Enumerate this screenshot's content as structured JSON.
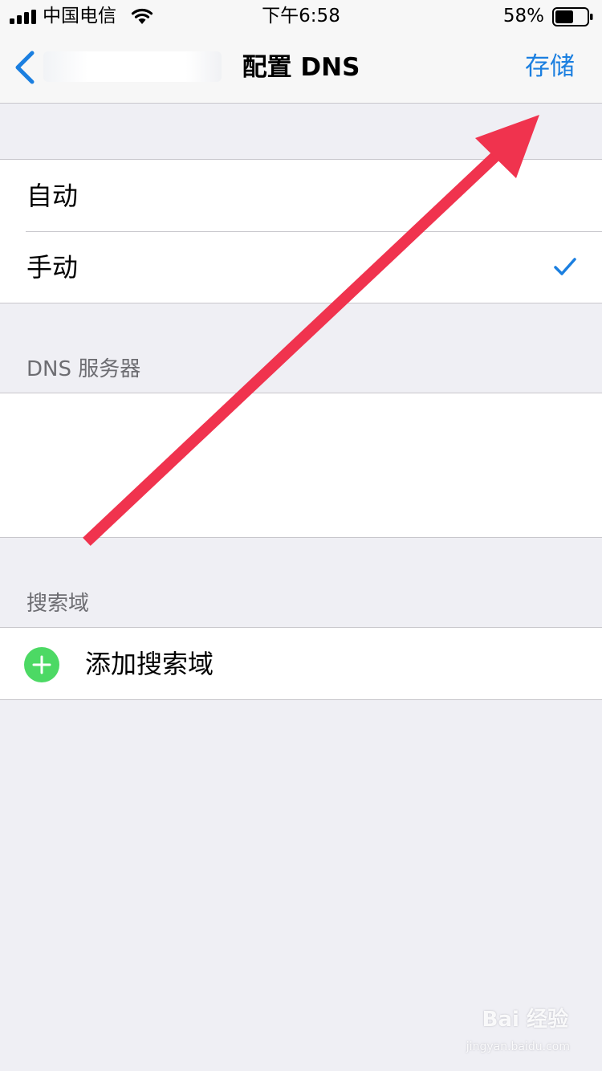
{
  "status_bar": {
    "carrier": "中国电信",
    "time": "下午6:58",
    "battery_percent": "58%",
    "battery_level": 0.58,
    "signal_icon": "signal-bars-icon",
    "wifi_icon": "wifi-icon"
  },
  "nav": {
    "title": "配置 DNS",
    "save_label": "存储",
    "back_icon": "chevron-left-icon"
  },
  "mode_options": [
    {
      "label": "自动",
      "selected": false
    },
    {
      "label": "手动",
      "selected": true
    }
  ],
  "dns_section": {
    "header": "DNS 服务器"
  },
  "search_section": {
    "header": "搜索域",
    "add_label": "添加搜索域",
    "add_icon": "plus-circle-icon"
  },
  "watermark": {
    "text": "Bai 经验",
    "sub": "jingyan.baidu.com"
  },
  "colors": {
    "accent": "#1b7fe0",
    "add_green": "#4cd964",
    "annotation_arrow": "#f0334e",
    "background": "#efeff4"
  }
}
